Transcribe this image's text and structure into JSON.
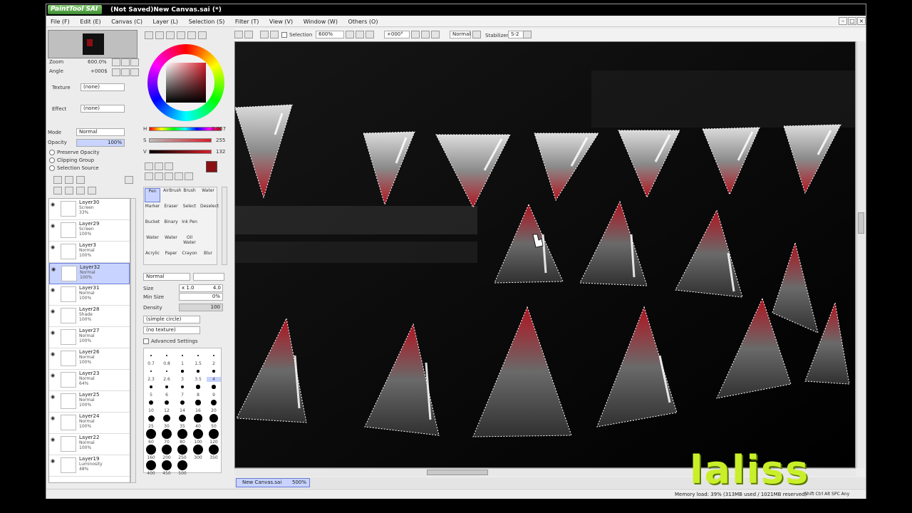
{
  "app": {
    "logo_text": "PaintTool SAI",
    "window_title": "(Not Saved)New Canvas.sai (*)"
  },
  "menu": [
    "File (F)",
    "Edit (E)",
    "Canvas (C)",
    "Layer (L)",
    "Selection (S)",
    "Filter (T)",
    "View (V)",
    "Window (W)",
    "Others (O)"
  ],
  "navigator": {
    "zoom_label": "Zoom",
    "zoom_value": "600.0%",
    "angle_label": "Angle",
    "angle_value": "+000$"
  },
  "layer_props": {
    "texture_label": "Texture",
    "texture_value": "(none)",
    "effect_label": "Effect",
    "effect_value": "(none)",
    "mode_label": "Mode",
    "mode_value": "Normal",
    "opacity_label": "Opacity",
    "opacity_value": "100%",
    "preserve_opacity": "Preserve Opacity",
    "clipping_group": "Clipping Group",
    "selection_source": "Selection Source"
  },
  "layers": [
    {
      "name": "Layer30",
      "mode": "Screen",
      "opacity": "33%",
      "selected": false
    },
    {
      "name": "Layer29",
      "mode": "Screen",
      "opacity": "100%",
      "selected": false
    },
    {
      "name": "Layer3",
      "mode": "Normal",
      "opacity": "100%",
      "selected": false
    },
    {
      "name": "Layer32",
      "mode": "Normal",
      "opacity": "100%",
      "selected": true
    },
    {
      "name": "Layer31",
      "mode": "Normal",
      "opacity": "100%",
      "selected": false
    },
    {
      "name": "Layer28",
      "mode": "Shade",
      "opacity": "100%",
      "selected": false
    },
    {
      "name": "Layer27",
      "mode": "Normal",
      "opacity": "100%",
      "selected": false
    },
    {
      "name": "Layer26",
      "mode": "Normal",
      "opacity": "100%",
      "selected": false
    },
    {
      "name": "Layer23",
      "mode": "Normal",
      "opacity": "64%",
      "selected": false
    },
    {
      "name": "Layer25",
      "mode": "Normal",
      "opacity": "100%",
      "selected": false
    },
    {
      "name": "Layer24",
      "mode": "Normal",
      "opacity": "100%",
      "selected": false
    },
    {
      "name": "Layer22",
      "mode": "Normal",
      "opacity": "100%",
      "selected": false
    },
    {
      "name": "Layer19",
      "mode": "Luminosity",
      "opacity": "48%",
      "selected": false
    }
  ],
  "color": {
    "h_label": "H",
    "h_value": "0.007",
    "s_label": "S",
    "s_value": "255",
    "v_label": "V",
    "v_value": "132",
    "current_color": "#8a0f12"
  },
  "tools": [
    [
      "Pen",
      "AirBrush",
      "Brush",
      "Water"
    ],
    [
      "Marker",
      "Eraser",
      "Select",
      "Deselect"
    ],
    [
      "Bucket",
      "Binary",
      "Ink Pen",
      ""
    ],
    [
      "Water",
      "Water",
      "Oil Water",
      ""
    ],
    [
      "Acrylic",
      "Paper",
      "Crayon",
      "Blur"
    ]
  ],
  "brush": {
    "mode": "Normal",
    "size_label": "Size",
    "size_mult": "x 1.0",
    "size_value": "4.0",
    "min_size_label": "Min Size",
    "min_size_value": "0%",
    "density_label": "Density",
    "density_value": "100",
    "shape": "(simple circle)",
    "texture": "(no texture)",
    "advanced": "Advanced Settings"
  },
  "brush_sizes": [
    "0.7",
    "0.8",
    "1",
    "1.5",
    "2",
    "2.3",
    "2.6",
    "3",
    "3.5",
    "4",
    "5",
    "6",
    "7",
    "8",
    "9",
    "10",
    "12",
    "14",
    "16",
    "20",
    "25",
    "30",
    "35",
    "40",
    "50",
    "60",
    "70",
    "80",
    "100",
    "120",
    "160",
    "200",
    "250",
    "300",
    "350",
    "400",
    "450",
    "500"
  ],
  "toolbar": {
    "selection_label": "Selection",
    "zoom_value": "600%",
    "angle_value": "+000°",
    "blend_mode": "Normal",
    "stabilizer_label": "Stabilizer",
    "stabilizer_value": "S-2"
  },
  "tab": {
    "name": "New Canvas.sai",
    "zoom": "500%"
  },
  "status": {
    "memory": "Memory load: 39% (313MB used / 1021MB reserved)",
    "keys": "Shift Ctrl Alt SPC Any"
  },
  "watermark": "laliss"
}
